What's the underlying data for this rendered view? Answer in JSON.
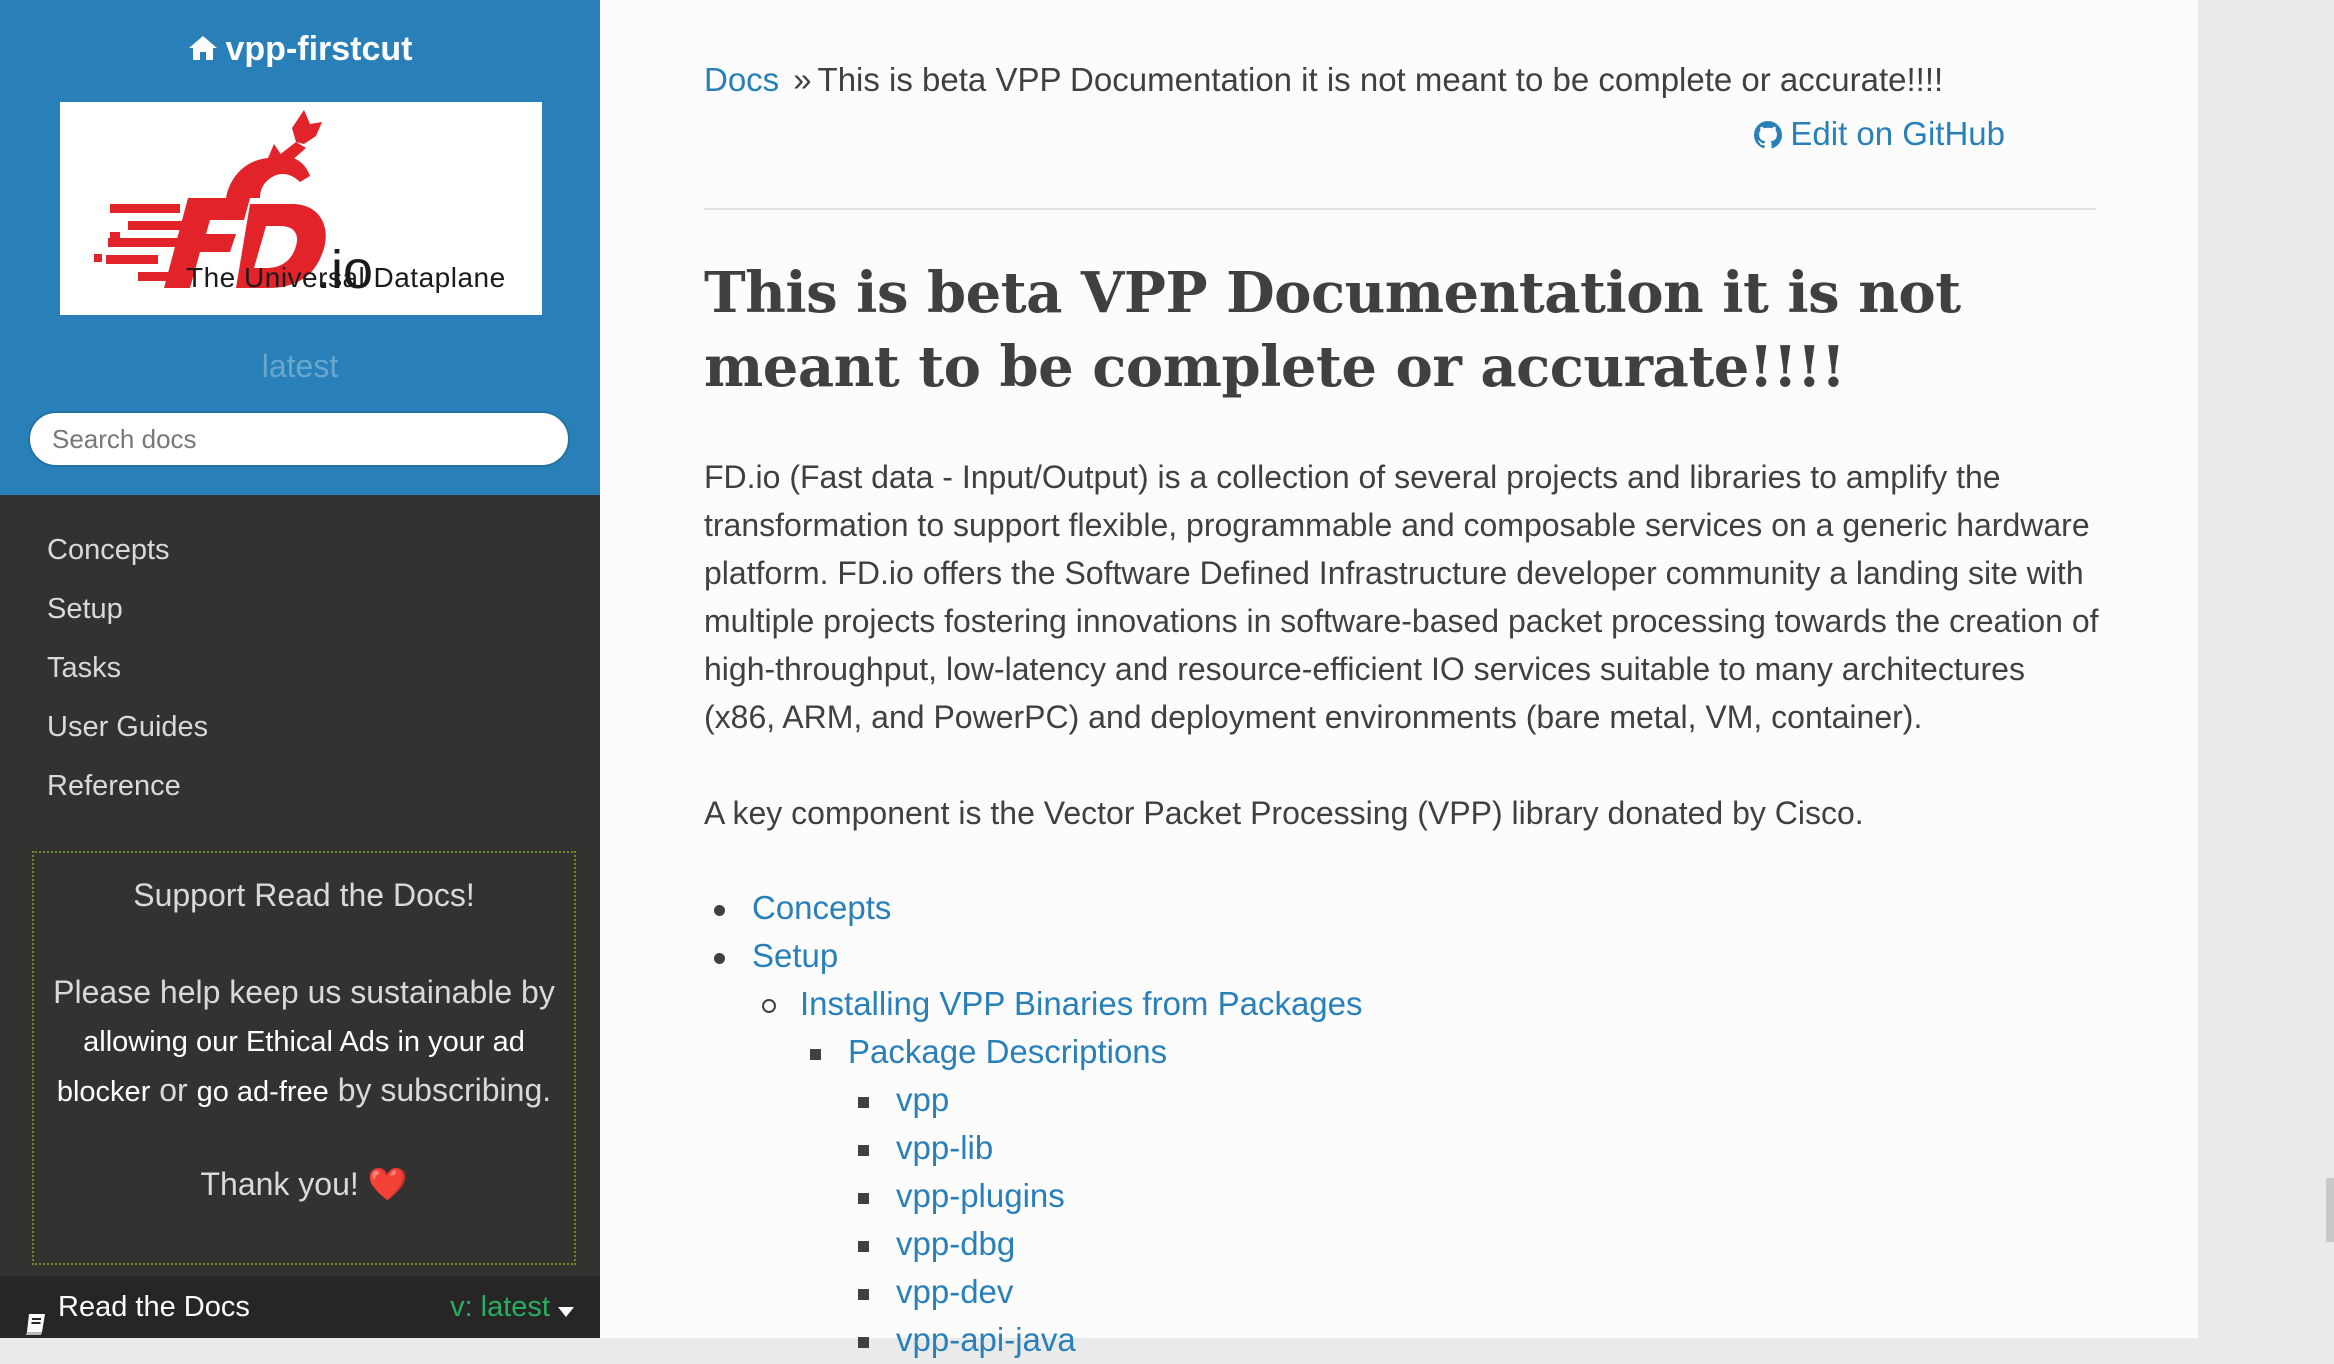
{
  "sidebar": {
    "project_name": "vpp-firstcut",
    "logo": {
      "wordmark": "FD.io",
      "tagline": "The Universal Dataplane"
    },
    "version": "latest",
    "search_placeholder": "Search docs",
    "nav_items": [
      {
        "label": "Concepts"
      },
      {
        "label": "Setup"
      },
      {
        "label": "Tasks"
      },
      {
        "label": "User Guides"
      },
      {
        "label": "Reference"
      }
    ],
    "ad": {
      "title": "Support Read the Docs!",
      "text_1": "Please help keep us sustainable by",
      "link_1": "allowing our Ethical Ads in your ad blocker",
      "text_2": "or",
      "link_2": "go ad-free",
      "text_3": "by subscribing.",
      "thanks": "Thank you!",
      "heart": "❤️"
    },
    "footer": {
      "label": "Read the Docs",
      "version": "v: latest"
    }
  },
  "content": {
    "breadcrumb": {
      "home": "Docs",
      "separator": "»",
      "current": "This is beta VPP Documentation it is not meant to be complete or accurate!!!!"
    },
    "edit_link": "Edit on GitHub",
    "title": "This is beta VPP Documentation it is not meant to be complete or accurate!!!!",
    "paragraphs": [
      "FD.io (Fast data - Input/Output) is a collection of several projects and libraries to amplify the transformation to support flexible, programmable and composable services on a generic hardware platform. FD.io offers the Software Defined Infrastructure developer community a landing site with multiple projects fostering innovations in software-based packet processing towards the creation of high-throughput, low-latency and resource-efficient IO services suitable to many architectures (x86, ARM, and PowerPC) and deployment environments (bare metal, VM, container).",
      "A key component is the Vector Packet Processing (VPP) library donated by Cisco."
    ],
    "toc": [
      {
        "label": "Concepts",
        "level": 1
      },
      {
        "label": "Setup",
        "level": 1
      },
      {
        "label": "Installing VPP Binaries from Packages",
        "level": 2
      },
      {
        "label": "Package Descriptions",
        "level": 3
      },
      {
        "label": "vpp",
        "level": 4
      },
      {
        "label": "vpp-lib",
        "level": 4
      },
      {
        "label": "vpp-plugins",
        "level": 4
      },
      {
        "label": "vpp-dbg",
        "level": 4
      },
      {
        "label": "vpp-dev",
        "level": 4
      },
      {
        "label": "vpp-api-java",
        "level": 4
      }
    ]
  },
  "colors": {
    "sidebar_top": "#2980b9",
    "sidebar_bg": "#343131",
    "link": "#2980b9",
    "text": "#404040",
    "version_green": "#27ae60",
    "logo_red": "#e3232a"
  }
}
